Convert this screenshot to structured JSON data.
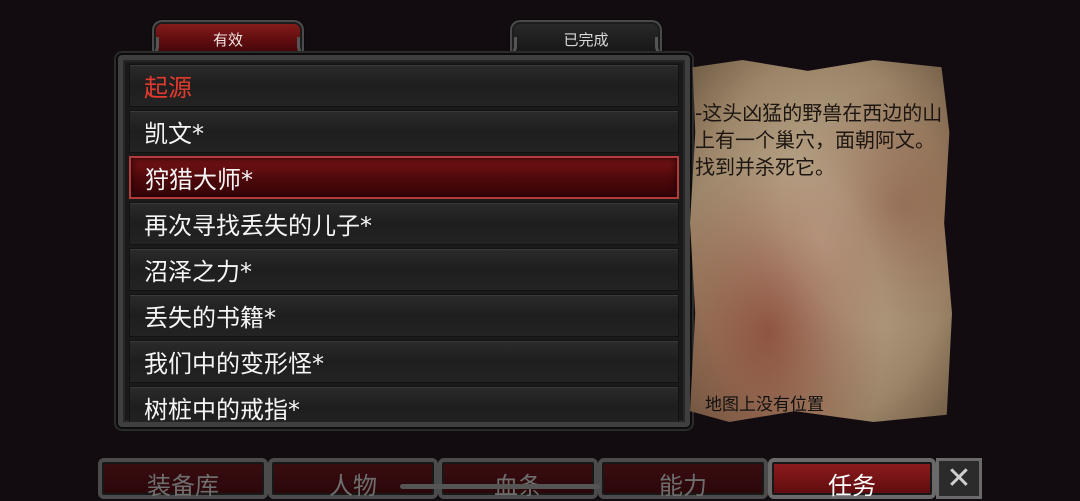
{
  "tabs": {
    "active": "有效",
    "completed": "已完成"
  },
  "quests": [
    {
      "label": "起源",
      "state": "header"
    },
    {
      "label": "凯文*",
      "state": "normal"
    },
    {
      "label": "狩猎大师*",
      "state": "selected"
    },
    {
      "label": "再次寻找丢失的儿子*",
      "state": "normal"
    },
    {
      "label": "沼泽之力*",
      "state": "normal"
    },
    {
      "label": "丢失的书籍*",
      "state": "normal"
    },
    {
      "label": "我们中的变形怪*",
      "state": "normal"
    },
    {
      "label": "树桩中的戒指*",
      "state": "normal"
    }
  ],
  "details": {
    "description": "-这头凶猛的野兽在西边的山上有一个巢穴，面朝阿文。 找到并杀死它。",
    "location": "地图上没有位置"
  },
  "nav": {
    "inventory": "装备库",
    "character": "人物",
    "bloodline": "血条",
    "abilities": "能力",
    "quests": "任务",
    "close": "✕"
  },
  "colors": {
    "accent_red": "#8e1c1e",
    "header_red": "#e23b2e"
  }
}
